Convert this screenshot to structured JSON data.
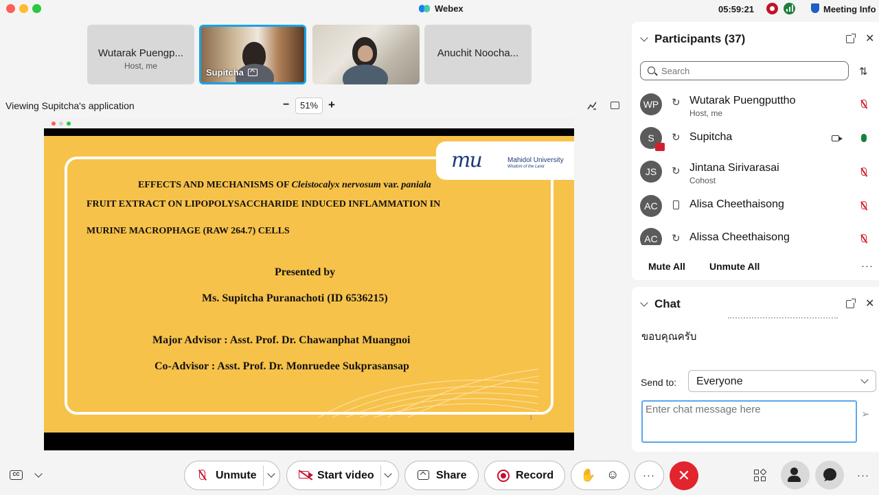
{
  "window": {
    "title": "Webex",
    "clock": "05:59:21",
    "meeting_info_label": "Meeting Info"
  },
  "video_strip": {
    "tiles": [
      {
        "name": "Wutarak Puengp...",
        "subtitle": "Host, me",
        "type": "avatar-tile"
      },
      {
        "name": "Supitcha",
        "type": "video",
        "selected": true
      },
      {
        "name": "",
        "type": "video"
      },
      {
        "name": "Anuchit Noocha...",
        "type": "avatar-tile"
      }
    ]
  },
  "share_bar": {
    "viewing_text": "Viewing Supitcha's application",
    "zoom_minus": "−",
    "zoom_value": "51%",
    "zoom_plus": "+"
  },
  "slide": {
    "logo_mark": "mu",
    "logo_name": "Mahidol University",
    "logo_tagline": "Wisdom of the Land",
    "title_line1_a": "EFFECTS AND MECHANISMS OF ",
    "title_line1_b": "Cleistocalyx nervosum",
    "title_line1_c": " var. ",
    "title_line1_d": "paniala",
    "title_line2": "FRUIT EXTRACT ON LIPOPOLYSACCHARIDE INDUCED INFLAMMATION IN",
    "title_line3": "MURINE MACROPHAGE (RAW 264.7) CELLS",
    "presented_by": "Presented by",
    "presenter": "Ms. Supitcha Puranachoti (ID 6536215)",
    "major_advisor": "Major Advisor :  Asst. Prof. Dr. Chawanphat Muangnoi",
    "co_advisor": "Co-Advisor :  Asst. Prof. Dr. Monruedee Sukprasansap",
    "page_number": "1",
    "background_color": "#f7c24a"
  },
  "participants": {
    "title": "Participants (37)",
    "search_placeholder": "Search",
    "list": [
      {
        "initials": "WP",
        "name": "Wutarak Puengputtho",
        "role": "Host, me",
        "mic": "muted"
      },
      {
        "initials": "S",
        "name": "Supitcha",
        "role": "",
        "mic": "on",
        "video": true,
        "sharing": true
      },
      {
        "initials": "JS",
        "name": "Jintana Sirivarasai",
        "role": "Cohost",
        "mic": "muted"
      },
      {
        "initials": "AC",
        "name": "Alisa Cheethaisong",
        "role": "",
        "mic": "muted",
        "device": "phone"
      },
      {
        "initials": "AC",
        "name": "Alissa Cheethaisong",
        "role": "",
        "mic": "muted"
      }
    ],
    "mute_all": "Mute All",
    "unmute_all": "Unmute All",
    "more": "···"
  },
  "chat": {
    "title": "Chat",
    "last_message": "ขอบคุณครับ",
    "send_to_label": "Send to:",
    "send_to_value": "Everyone",
    "input_placeholder": "Enter chat message here"
  },
  "controls": {
    "cc_label": "CC",
    "unmute": "Unmute",
    "start_video": "Start video",
    "share": "Share",
    "record": "Record",
    "more": "···",
    "end": "✕",
    "panel_more": "···"
  },
  "colors": {
    "accent_blue": "#19a1e6",
    "end_red": "#e2242d",
    "muted_red": "#c8102e",
    "mic_green": "#1a7f3c"
  }
}
